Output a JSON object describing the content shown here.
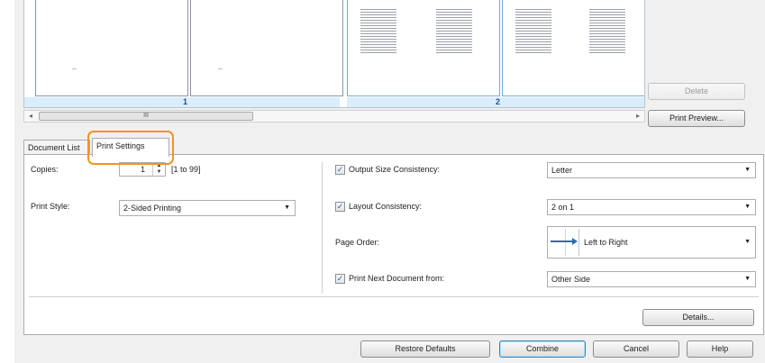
{
  "preview": {
    "group_labels": [
      "1",
      "2"
    ],
    "scroll_thumb_label": "III",
    "scroll_left": "◂",
    "scroll_right": "▸"
  },
  "buttons": {
    "delete": "Delete",
    "print_preview": "Print Preview...",
    "details": "Details...",
    "restore_defaults": "Restore Defaults",
    "combine": "Combine",
    "cancel": "Cancel",
    "help": "Help"
  },
  "tabs": [
    {
      "label": "Document List",
      "active": false
    },
    {
      "label": "Print Settings",
      "active": true
    }
  ],
  "settings": {
    "copies_label": "Copies:",
    "copies_value": "1",
    "copies_range": "[1 to 99]",
    "print_style_label": "Print Style:",
    "print_style_value": "2-Sided Printing",
    "output_size_label": "Output Size Consistency:",
    "output_size_value": "Letter",
    "output_size_checked": true,
    "layout_label": "Layout Consistency:",
    "layout_value": "2 on 1",
    "layout_checked": true,
    "page_order_label": "Page Order:",
    "page_order_value": "Left to Right",
    "next_doc_label": "Print Next Document from:",
    "next_doc_value": "Other Side",
    "next_doc_checked": true
  },
  "icons": {
    "check": "✓",
    "dropdown": "▼",
    "spin_up": "▲",
    "spin_down": "▼"
  },
  "colors": {
    "highlight": "#f29321",
    "group_band": "#d9eefa",
    "page_order_arrow": "#2b6cb0"
  }
}
